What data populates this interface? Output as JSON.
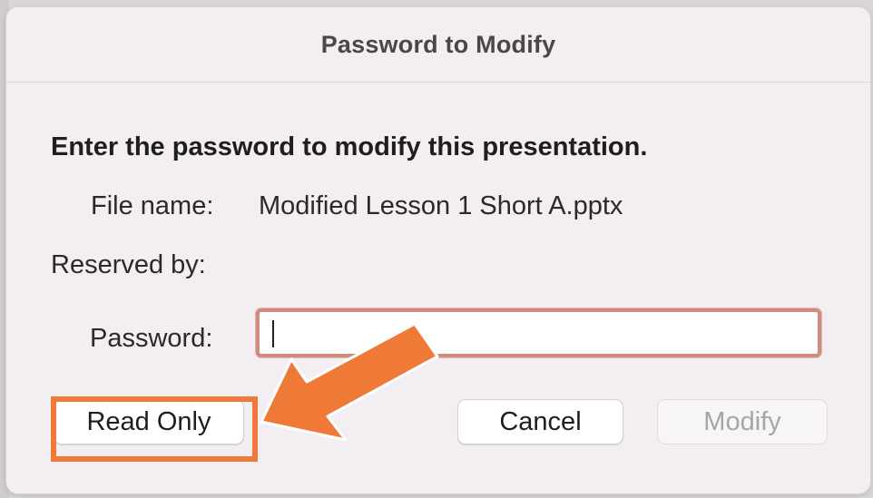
{
  "dialog": {
    "title": "Password to Modify",
    "heading": "Enter the password to modify this presentation.",
    "file_name_label": "File name:",
    "file_name_value": "Modified Lesson 1 Short A.pptx",
    "reserved_by_label": "Reserved by:",
    "password_label": "Password:",
    "password_value": ""
  },
  "buttons": {
    "read_only": "Read Only",
    "cancel": "Cancel",
    "modify": "Modify"
  },
  "annotation": {
    "highlight_color": "#f07838",
    "arrow_color": "#ef7a37",
    "arrow_icon": "orange-arrow-icon"
  }
}
